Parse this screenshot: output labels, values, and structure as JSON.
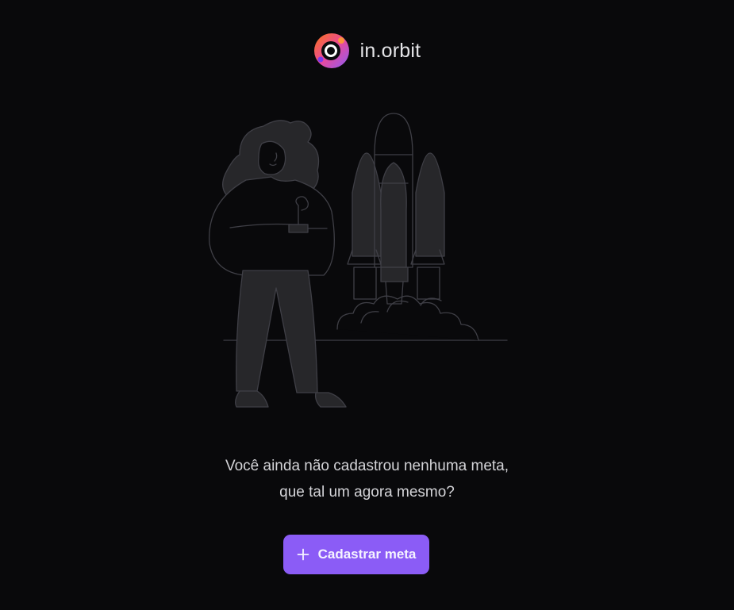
{
  "brand": {
    "name": "in.orbit",
    "logo_icon": "orbit-logo-icon",
    "logo_colors": [
      "#f97316",
      "#ec4899",
      "#8b5cf6"
    ]
  },
  "empty_state": {
    "illustration": "woman-launching-rocket-illustration",
    "message_line_1": "Você ainda não cadastrou nenhuma meta,",
    "message_line_2": "que tal um agora mesmo?"
  },
  "actions": {
    "create_goal_icon": "plus-icon",
    "create_goal_label": "Cadastrar meta"
  },
  "colors": {
    "background": "#09090b",
    "accent": "#8b5cf6",
    "text": "#d4d4d8"
  }
}
